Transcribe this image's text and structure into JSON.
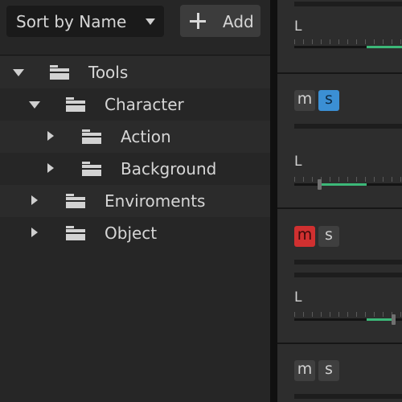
{
  "toolbar": {
    "sort_label": "Sort by Name",
    "add_label": "Add"
  },
  "tree": [
    {
      "label": "Tools",
      "depth": 0,
      "expanded": true
    },
    {
      "label": "Character",
      "depth": 1,
      "expanded": true
    },
    {
      "label": "Action",
      "depth": 2,
      "expanded": false
    },
    {
      "label": "Background",
      "depth": 2,
      "expanded": false
    },
    {
      "label": "Enviroments",
      "depth": 1,
      "expanded": false
    },
    {
      "label": "Object",
      "depth": 1,
      "expanded": false
    }
  ],
  "tracks": [
    {
      "pan_label": "L",
      "pan_fill": [
        0.67,
        1.0
      ]
    },
    {
      "mute_label": "m",
      "solo_label": "s",
      "solo_active": true,
      "mute_active": false,
      "pan_label": "L",
      "pan_fill": [
        0.23,
        0.67
      ]
    },
    {
      "mute_label": "m",
      "solo_label": "s",
      "solo_active": false,
      "mute_active": true,
      "pan_label": "L",
      "pan_fill": [
        0.67,
        0.92
      ]
    },
    {
      "mute_label": "m",
      "solo_label": "s",
      "solo_active": false,
      "mute_active": false
    }
  ],
  "colors": {
    "solo_active": "#3b8fd4",
    "mute_active": "#d03030",
    "pan_fill": "#3cb878"
  }
}
